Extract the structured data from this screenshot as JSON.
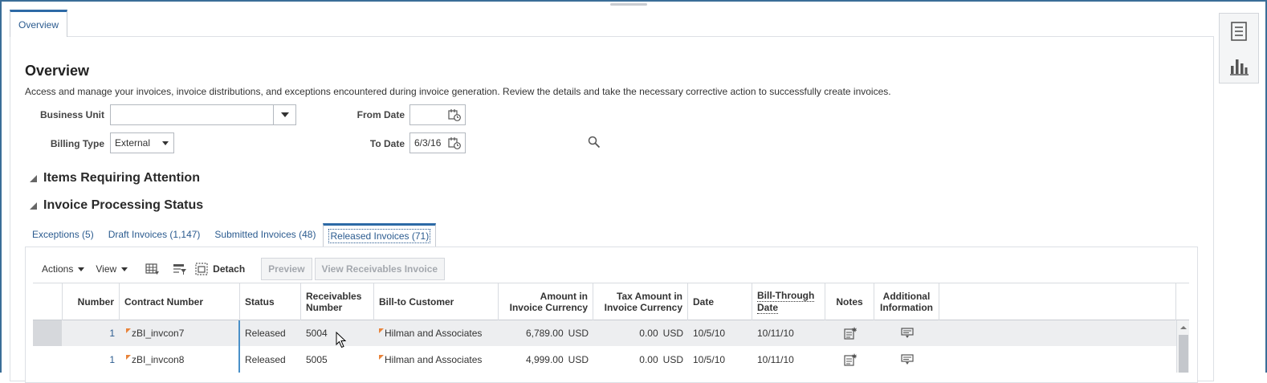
{
  "tabs": [
    {
      "label": "Overview",
      "active": true
    }
  ],
  "page": {
    "title": "Overview",
    "description": "Access and manage your invoices, invoice distributions, and exceptions encountered during invoice generation. Review the details and take the necessary corrective action to successfully create invoices."
  },
  "filters": {
    "business_unit": {
      "label": "Business Unit",
      "value": ""
    },
    "billing_type": {
      "label": "Billing Type",
      "value": "External"
    },
    "from_date": {
      "label": "From Date",
      "value": ""
    },
    "to_date": {
      "label": "To Date",
      "value": "6/3/16"
    }
  },
  "sections": {
    "items_attention": "Items Requiring Attention",
    "processing_status": "Invoice Processing Status"
  },
  "subtabs": [
    {
      "label": "Exceptions (5)"
    },
    {
      "label": "Draft Invoices (1,147)"
    },
    {
      "label": "Submitted Invoices (48)"
    },
    {
      "label": "Released Invoices (71)",
      "active": true
    }
  ],
  "toolbar": {
    "actions": "Actions",
    "view": "View",
    "detach": "Detach",
    "preview": "Preview",
    "view_receivables": "View Receivables Invoice"
  },
  "table": {
    "columns": {
      "number": "Number",
      "contract": "Contract Number",
      "status": "Status",
      "recv_1": "Receivables",
      "recv_2": "Number",
      "customer": "Bill-to Customer",
      "amount_1": "Amount in",
      "amount_2": "Invoice Currency",
      "tax_1": "Tax Amount in",
      "tax_2": "Invoice Currency",
      "date": "Date",
      "bill_1": "Bill-Through",
      "bill_2": "Date",
      "notes": "Notes",
      "addl_1": "Additional",
      "addl_2": "Information"
    },
    "rows": [
      {
        "number": "1",
        "contract": "zBI_invcon7",
        "status": "Released",
        "receivables": "5004",
        "customer": "Hilman and Associates",
        "amount": "6,789.00",
        "amount_cur": "USD",
        "tax": "0.00",
        "tax_cur": "USD",
        "date": "10/5/10",
        "bill_through": "10/11/10"
      },
      {
        "number": "1",
        "contract": "zBI_invcon8",
        "status": "Released",
        "receivables": "5005",
        "customer": "Hilman and Associates",
        "amount": "4,999.00",
        "amount_cur": "USD",
        "tax": "0.00",
        "tax_cur": "USD",
        "date": "10/5/10",
        "bill_through": "10/11/10"
      }
    ]
  },
  "colors": {
    "accent": "#2d6aa6",
    "link": "#2b5b8f",
    "frame": "#3a6d97",
    "flag": "#e8833a"
  },
  "icons": [
    "document-list-icon",
    "bar-chart-icon",
    "search-icon",
    "calendar-icon",
    "dropdown-caret-icon",
    "freeze-columns-icon",
    "query-by-example-icon",
    "detach-icon",
    "add-note-icon",
    "additional-info-icon",
    "disclosure-triangle-icon"
  ]
}
